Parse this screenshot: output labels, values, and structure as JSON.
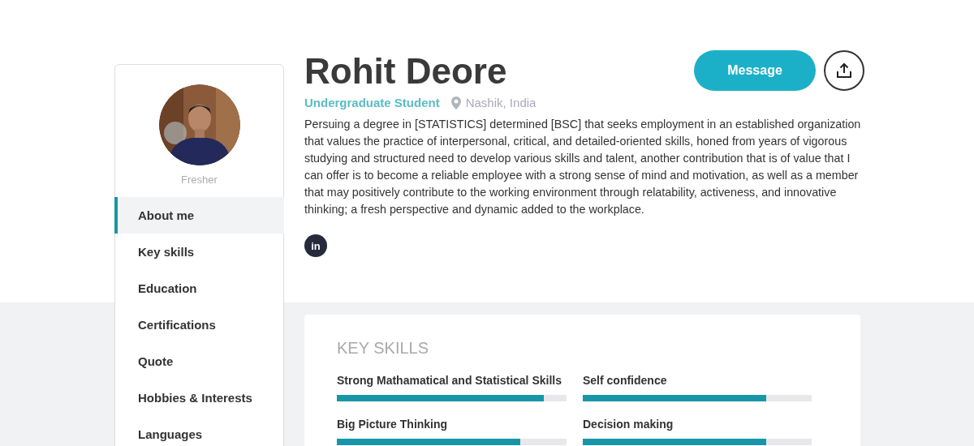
{
  "profile": {
    "name": "Rohit Deore",
    "role": "Undergraduate Student",
    "location": "Nashik, India",
    "status": "Fresher",
    "about": "Persuing a degree in [STATISTICS] determined [BSC] that seeks employment in an established organization that values the practice of interpersonal, critical, and detailed-oriented skills, honed from years of vigorous studying and structured need to develop various skills and talent, another contribution that is of value that I can offer is to become a reliable employee with a strong sense of mind and motivation, as well as a member that may positively contribute to the working environment through relatability, activeness, and innovative thinking; a fresh perspective and dynamic added to the workplace.",
    "message_button": "Message",
    "social": [
      {
        "label": "in"
      }
    ]
  },
  "sidebar": {
    "items": [
      {
        "label": "About me",
        "selected": true
      },
      {
        "label": "Key skills",
        "selected": false
      },
      {
        "label": "Education",
        "selected": false
      },
      {
        "label": "Certifications",
        "selected": false
      },
      {
        "label": "Quote",
        "selected": false
      },
      {
        "label": "Hobbies & Interests",
        "selected": false
      },
      {
        "label": "Languages",
        "selected": false
      }
    ]
  },
  "key_skills": {
    "title": "KEY SKILLS",
    "skills": [
      {
        "name": "Strong Mathamatical and Statistical Skills",
        "level": 0.9
      },
      {
        "name": "Self confidence",
        "level": 0.8
      },
      {
        "name": "Big Picture Thinking",
        "level": 0.8
      },
      {
        "name": "Decision making",
        "level": 0.8
      }
    ]
  }
}
